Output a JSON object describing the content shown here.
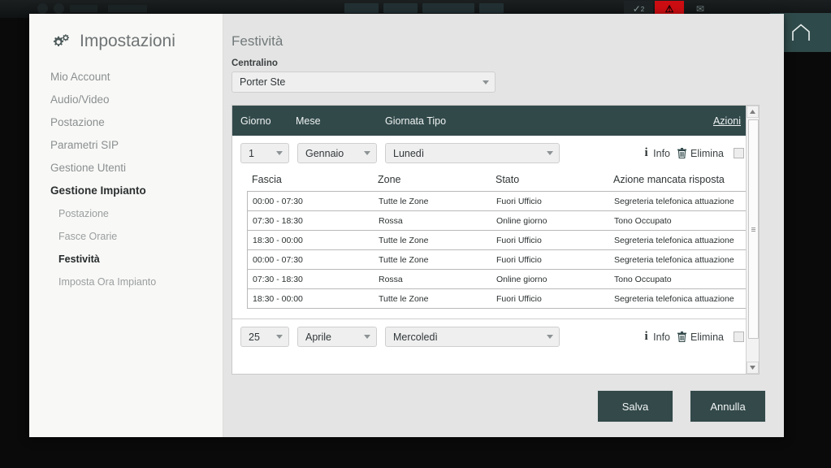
{
  "background": {
    "home_icon": "home-icon",
    "toolbar_icons": [
      {
        "name": "check-badge-icon",
        "glyph": "✓",
        "badge": "2"
      },
      {
        "name": "alert-warning-icon",
        "glyph": "⚠"
      },
      {
        "name": "mail-icon",
        "glyph": "✉"
      }
    ]
  },
  "modal": {
    "sidebar": {
      "gear_icon": "gear-icon",
      "title": "Impostazioni",
      "items": [
        {
          "label": "Mio Account",
          "active": false,
          "sub": false
        },
        {
          "label": "Audio/Video",
          "active": false,
          "sub": false
        },
        {
          "label": "Postazione",
          "active": false,
          "sub": false
        },
        {
          "label": "Parametri SIP",
          "active": false,
          "sub": false
        },
        {
          "label": "Gestione Utenti",
          "active": false,
          "sub": false
        },
        {
          "label": "Gestione Impianto",
          "active": true,
          "sub": false
        },
        {
          "label": "Postazione",
          "active": false,
          "sub": true
        },
        {
          "label": "Fasce Orarie",
          "active": false,
          "sub": true
        },
        {
          "label": "Festività",
          "active": true,
          "sub": true
        },
        {
          "label": "Imposta Ora Impianto",
          "active": false,
          "sub": true
        }
      ]
    },
    "content": {
      "page_title": "Festività",
      "centralino_label": "Centralino",
      "centralino_value": "Porter Ste",
      "table_headers": {
        "giorno": "Giorno",
        "mese": "Mese",
        "giornata_tipo": "Giornata Tipo",
        "azioni": "Azioni"
      },
      "sub_headers": {
        "fascia": "Fascia",
        "zone": "Zone",
        "stato": "Stato",
        "azione": "Azione mancata risposta"
      },
      "actions": {
        "info_label": "Info",
        "elimina_label": "Elimina",
        "info_icon": "info-icon",
        "trash_icon": "trash-icon",
        "checkbox": "row-checkbox"
      },
      "entries": [
        {
          "giorno": "1",
          "mese": "Gennaio",
          "giornata_tipo": "Lunedì",
          "rows": [
            {
              "fascia": "00:00 - 07:30",
              "zone": "Tutte le Zone",
              "stato": "Fuori Ufficio",
              "azione": "Segreteria telefonica attuazione"
            },
            {
              "fascia": "07:30 - 18:30",
              "zone": "Rossa",
              "stato": "Online giorno",
              "azione": "Tono Occupato"
            },
            {
              "fascia": "18:30 - 00:00",
              "zone": "Tutte le Zone",
              "stato": "Fuori Ufficio",
              "azione": "Segreteria telefonica attuazione"
            },
            {
              "fascia": "00:00 - 07:30",
              "zone": "Tutte le Zone",
              "stato": "Fuori Ufficio",
              "azione": "Segreteria telefonica attuazione"
            },
            {
              "fascia": "07:30 - 18:30",
              "zone": "Rossa",
              "stato": "Online giorno",
              "azione": "Tono Occupato"
            },
            {
              "fascia": "18:30 - 00:00",
              "zone": "Tutte le Zone",
              "stato": "Fuori Ufficio",
              "azione": "Segreteria telefonica attuazione"
            }
          ]
        },
        {
          "giorno": "25",
          "mese": "Aprile",
          "giornata_tipo": "Mercoledì",
          "rows": []
        }
      ],
      "scrollbar": {
        "up_arrow": "scroll-up-arrow",
        "down_arrow": "scroll-down-arrow",
        "thumb": "scroll-thumb"
      }
    },
    "footer": {
      "save_label": "Salva",
      "cancel_label": "Annulla"
    }
  },
  "colors": {
    "accent_dark": "#33494a",
    "modal_bg": "#e4e4e4",
    "sidebar_bg": "#f8f8f6",
    "alert_red": "#cc0d12"
  }
}
